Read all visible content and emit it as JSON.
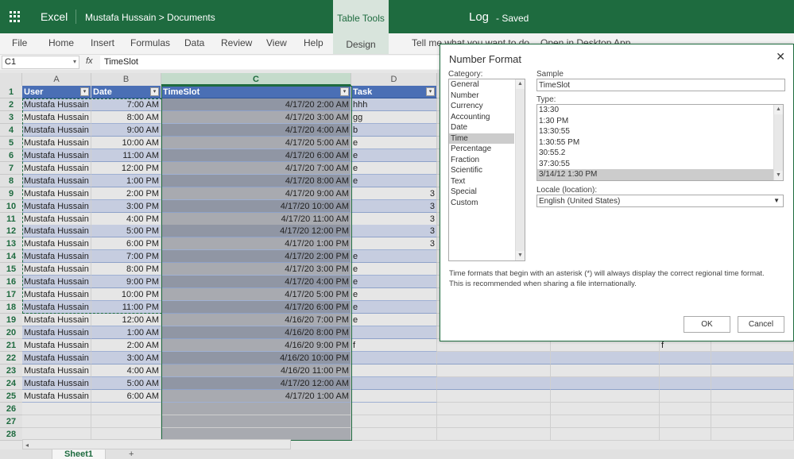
{
  "header": {
    "app": "Excel",
    "breadcrumb": "Mustafa Hussain > Documents",
    "context_tab": "Table Tools",
    "doc_title": "Log",
    "status": "-  Saved",
    "accent": "#1e6b3f"
  },
  "ribbon": {
    "tabs": [
      "File",
      "Home",
      "Insert",
      "Formulas",
      "Data",
      "Review",
      "View",
      "Help"
    ],
    "context_tab": "Design",
    "tell_me": "Tell me what you want to do",
    "open_desktop": "Open in Desktop App"
  },
  "formula_bar": {
    "name_box": "C1",
    "fx": "fx",
    "value": "TimeSlot"
  },
  "sheet": {
    "columns": [
      "A",
      "B",
      "C",
      "D"
    ],
    "selected_column": "C",
    "headers": [
      "User",
      "Date",
      "TimeSlot",
      "Task"
    ],
    "rows": [
      [
        "Mustafa Hussain",
        "7:00 AM",
        "4/17/20 2:00 AM",
        "hhh"
      ],
      [
        "Mustafa Hussain",
        "8:00 AM",
        "4/17/20 3:00 AM",
        "gg"
      ],
      [
        "Mustafa Hussain",
        "9:00 AM",
        "4/17/20 4:00 AM",
        "b"
      ],
      [
        "Mustafa Hussain",
        "10:00 AM",
        "4/17/20 5:00 AM",
        "e"
      ],
      [
        "Mustafa Hussain",
        "11:00 AM",
        "4/17/20 6:00 AM",
        "e"
      ],
      [
        "Mustafa Hussain",
        "12:00 PM",
        "4/17/20 7:00 AM",
        "e"
      ],
      [
        "Mustafa Hussain",
        "1:00 PM",
        "4/17/20 8:00 AM",
        "e"
      ],
      [
        "Mustafa Hussain",
        "2:00 PM",
        "4/17/20 9:00 AM",
        "3"
      ],
      [
        "Mustafa Hussain",
        "3:00 PM",
        "4/17/20 10:00 AM",
        "3"
      ],
      [
        "Mustafa Hussain",
        "4:00 PM",
        "4/17/20 11:00 AM",
        "3"
      ],
      [
        "Mustafa Hussain",
        "5:00 PM",
        "4/17/20 12:00 PM",
        "3"
      ],
      [
        "Mustafa Hussain",
        "6:00 PM",
        "4/17/20 1:00 PM",
        "3"
      ],
      [
        "Mustafa Hussain",
        "7:00 PM",
        "4/17/20 2:00 PM",
        "e"
      ],
      [
        "Mustafa Hussain",
        "8:00 PM",
        "4/17/20 3:00 PM",
        "e"
      ],
      [
        "Mustafa Hussain",
        "9:00 PM",
        "4/17/20 4:00 PM",
        "e"
      ],
      [
        "Mustafa Hussain",
        "10:00 PM",
        "4/17/20 5:00 PM",
        "e"
      ],
      [
        "Mustafa Hussain",
        "11:00 PM",
        "4/17/20 6:00 PM",
        "e"
      ],
      [
        "Mustafa Hussain",
        "12:00 AM",
        "4/16/20 7:00 PM",
        "e"
      ],
      [
        "Mustafa Hussain",
        "1:00 AM",
        "4/16/20 8:00 PM",
        ""
      ],
      [
        "Mustafa Hussain",
        "2:00 AM",
        "4/16/20 9:00 PM",
        "f"
      ],
      [
        "Mustafa Hussain",
        "3:00 AM",
        "4/16/20 10:00 PM",
        ""
      ],
      [
        "Mustafa Hussain",
        "4:00 AM",
        "4/16/20 11:00 PM",
        ""
      ],
      [
        "Mustafa Hussain",
        "5:00 AM",
        "4/17/20 12:00 AM",
        ""
      ],
      [
        "Mustafa Hussain",
        "6:00 AM",
        "4/17/20 1:00 AM",
        ""
      ]
    ],
    "extra_cell_row21": "f",
    "row_numbers": [
      "1",
      "2",
      "3",
      "4",
      "5",
      "6",
      "7",
      "8",
      "9",
      "10",
      "11",
      "12",
      "13",
      "14",
      "15",
      "16",
      "17",
      "18",
      "19",
      "20",
      "21",
      "22",
      "23",
      "24",
      "25",
      "26",
      "27",
      "28"
    ],
    "sheet_tab": "Sheet1",
    "add_sheet": "+"
  },
  "dialog": {
    "title": "Number Format",
    "close": "✕",
    "category_label": "Category:",
    "categories": [
      "General",
      "Number",
      "Currency",
      "Accounting",
      "Date",
      "Time",
      "Percentage",
      "Fraction",
      "Scientific",
      "Text",
      "Special",
      "Custom"
    ],
    "selected_category": "Time",
    "sample_label": "Sample",
    "sample_value": "TimeSlot",
    "type_label": "Type:",
    "types": [
      "13:30",
      "1:30 PM",
      "13:30:55",
      "1:30:55 PM",
      "30:55.2",
      "37:30:55",
      "3/14/12 1:30 PM"
    ],
    "selected_type": "3/14/12 1:30 PM",
    "locale_label": "Locale (location):",
    "locale_value": "English (United States)",
    "note_line1": "Time formats that begin with an asterisk (*) will always display the correct regional time format.",
    "note_line2": "This is recommended when sharing a file internationally.",
    "ok": "OK",
    "cancel": "Cancel"
  }
}
